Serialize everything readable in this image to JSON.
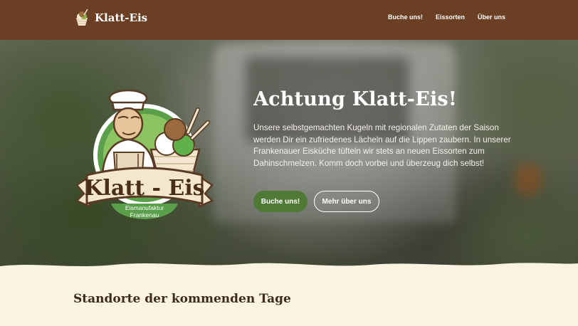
{
  "header": {
    "brand_name": "Klatt-Eis",
    "nav": [
      "Buche uns!",
      "Eissorten",
      "Über uns"
    ]
  },
  "badge": {
    "title": "Klatt - Eis",
    "subtitle_line1": "Eismanufaktur",
    "subtitle_line2": "Frankenau"
  },
  "hero": {
    "title": "Achtung Klatt-Eis!",
    "text": "Unsere selbstgemachten Kugeln mit regionalen Zutaten der Saison werden Dir ein zufriedenes Lächeln auf die Lippen zaubern. In unserer Frankenauer Eisküche tüfteln wir stets an neuen Eissorten zum Dahinschmelzen. Komm doch vorbei und überzeug dich selbst!",
    "primary_button": "Buche uns!",
    "secondary_button": "Mehr über uns"
  },
  "section": {
    "title": "Standorte der kommenden Tage"
  },
  "colors": {
    "header_brown": "#6b3f24",
    "cream": "#fbf3e2",
    "green": "#4f7a35",
    "white": "#ffffff"
  },
  "icons": [
    "ice-cream-cup-icon",
    "klatt-eis-badge-logo"
  ]
}
